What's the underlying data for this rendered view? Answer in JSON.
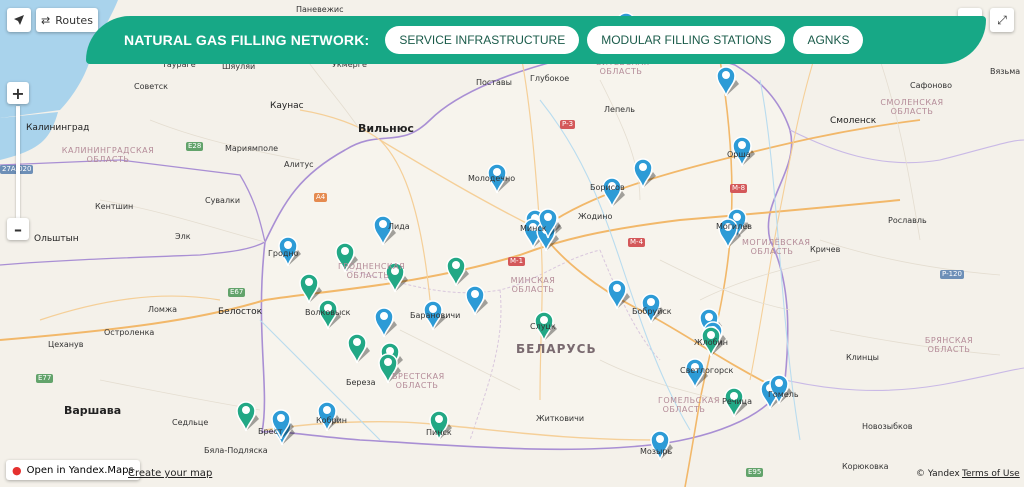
{
  "banner": {
    "title": "NATURAL GAS FILLING NETWORK:",
    "buttons": [
      "SERVICE INFRASTRUCTURE",
      "MODULAR FILLING STATIONS",
      "AGNKS"
    ],
    "color": "#17a886"
  },
  "controls": {
    "routes_label": "Routes",
    "zoom_in": "+",
    "zoom_out": "–",
    "open_label": "Open in Yandex.Maps",
    "create_label": "Create your map",
    "copyright": "© Yandex",
    "terms": "Terms of Use"
  },
  "marker_colors": {
    "service": "#2d9bd6",
    "modular": "#22a885"
  },
  "labels": {
    "cities": [
      "Вильнюс",
      "Каунас",
      "Калининград",
      "Мариямполе",
      "Алитус",
      "Кентшин",
      "Сувалки",
      "Ольштын",
      "Элк",
      "Белосток",
      "Ломжа",
      "Остроленка",
      "Цеханув",
      "Варшава",
      "Седльце",
      "Бяла-Подляска",
      "Советск",
      "Таураге",
      "Шяуляй",
      "Паневежис",
      "Укмерге",
      "Поставы",
      "Глубокое",
      "Лепель",
      "Молодечно",
      "Жодино",
      "Борисов",
      "Орша",
      "Могилёв",
      "Смоленск",
      "Сафоново",
      "Вязьма",
      "Рославль",
      "Кричев",
      "Бобруйск",
      "Слуцк",
      "Барановичи",
      "Брест",
      "Кобрин",
      "Пинск",
      "Житковичи",
      "Мозырь",
      "Жлобин",
      "Светлогорск",
      "Речица",
      "Гомель",
      "Клинцы",
      "Новозыбков",
      "Береза",
      "Волковыск",
      "Гродно",
      "Лида",
      "Минск",
      "Корюковка"
    ],
    "regions": [
      "МИНСКАЯ ОБЛАСТЬ",
      "ГРОДНЕНСКАЯ ОБЛАСТЬ",
      "БРЕСТСКАЯ ОБЛАСТЬ",
      "ГОМЕЛЬСКАЯ ОБЛАСТЬ",
      "МОГИЛЁВСКАЯ ОБЛАСТЬ",
      "ВИТЕБСКАЯ ОБЛАСТЬ",
      "СМОЛЕНСКАЯ ОБЛАСТЬ",
      "БРЯНСКАЯ ОБЛАСТЬ",
      "КАЛИНИНГРАДСКАЯ ОБЛАСТЬ"
    ],
    "country": "БЕЛАРУСЬ",
    "roads": [
      "M-1",
      "M-4",
      "M-8",
      "P-3",
      "E28",
      "E67",
      "E77",
      "E95",
      "P-120",
      "A4",
      "27A-020"
    ]
  },
  "markers": [
    {
      "type": "service"
    },
    {
      "type": "service"
    },
    {
      "type": "service"
    },
    {
      "type": "service"
    },
    {
      "type": "service"
    },
    {
      "type": "service"
    },
    {
      "type": "service"
    },
    {
      "type": "service"
    },
    {
      "type": "service"
    },
    {
      "type": "service"
    },
    {
      "type": "service"
    },
    {
      "type": "service"
    },
    {
      "type": "service"
    },
    {
      "type": "service"
    },
    {
      "type": "service"
    },
    {
      "type": "service"
    },
    {
      "type": "service"
    },
    {
      "type": "service"
    },
    {
      "type": "service"
    },
    {
      "type": "service"
    },
    {
      "type": "service"
    },
    {
      "type": "service"
    },
    {
      "type": "service"
    },
    {
      "type": "service"
    },
    {
      "type": "service"
    },
    {
      "type": "service"
    },
    {
      "type": "service"
    },
    {
      "type": "service"
    },
    {
      "type": "service"
    },
    {
      "type": "modular"
    },
    {
      "type": "modular"
    },
    {
      "type": "modular"
    },
    {
      "type": "modular"
    },
    {
      "type": "modular"
    },
    {
      "type": "modular"
    },
    {
      "type": "modular"
    },
    {
      "type": "modular"
    },
    {
      "type": "modular"
    },
    {
      "type": "modular"
    },
    {
      "type": "modular"
    },
    {
      "type": "modular"
    },
    {
      "type": "modular"
    }
  ]
}
